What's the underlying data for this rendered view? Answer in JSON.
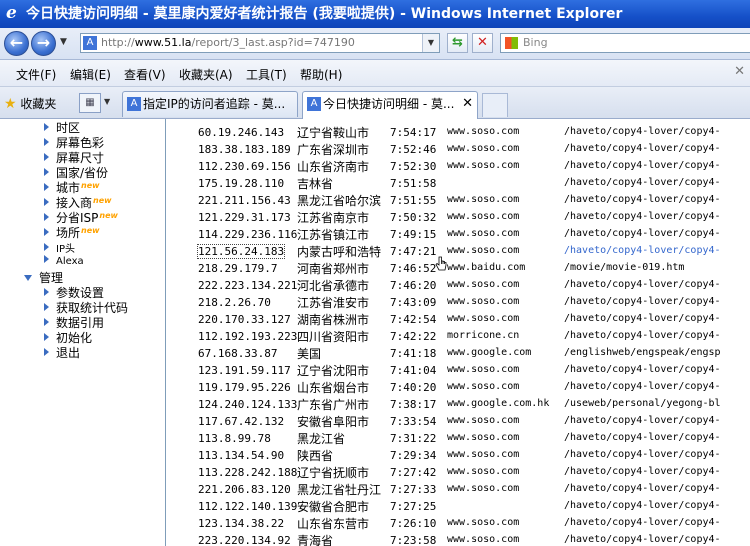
{
  "window": {
    "title": "今日快捷访问明细 - 莫里康内爱好者统计报告 (我要啦提供) - Windows Internet Explorer"
  },
  "navbar": {
    "back_icon": "back-arrow-icon",
    "forward_icon": "forward-arrow-icon",
    "address_prefix": "http://",
    "address_host": "www.51.la",
    "address_path": "/report/3_last.asp?id=747190",
    "search_placeholder": "Bing"
  },
  "menu": {
    "items": [
      "文件(F)",
      "编辑(E)",
      "查看(V)",
      "收藏夹(A)",
      "工具(T)",
      "帮助(H)"
    ],
    "close_label": "✕"
  },
  "tabs": {
    "favorites_label": "收藏夹",
    "items": [
      {
        "label": "指定IP的访问者追踪 - 莫...",
        "active": false
      },
      {
        "label": "今日快捷访问明细 - 莫...",
        "active": true
      }
    ]
  },
  "sidebar": {
    "items": [
      {
        "label": "时区",
        "new": false
      },
      {
        "label": "屏幕色彩",
        "new": false
      },
      {
        "label": "屏幕尺寸",
        "new": false
      },
      {
        "label": "国家/省份",
        "new": false
      },
      {
        "label": "城市",
        "new": true
      },
      {
        "label": "接入商",
        "new": true
      },
      {
        "label": "分省ISP",
        "new": true
      },
      {
        "label": "场所",
        "new": true
      },
      {
        "label": "IP头",
        "new": false
      },
      {
        "label": "Alexa",
        "new": false
      }
    ],
    "section_label": "管理",
    "manage_items": [
      "参数设置",
      "获取统计代码",
      "数据引用",
      "初始化",
      "退出"
    ],
    "new_badge_text": "new"
  },
  "rows": [
    {
      "ip": "60.19.246.143",
      "loc": "辽宁省鞍山市",
      "time": "7:54:17",
      "src": "www.soso.com",
      "page": "/haveto/copy4-lover/copy4-"
    },
    {
      "ip": "183.38.183.189",
      "loc": "广东省深圳市",
      "time": "7:52:46",
      "src": "www.soso.com",
      "page": "/haveto/copy4-lover/copy4-"
    },
    {
      "ip": "112.230.69.156",
      "loc": "山东省济南市",
      "time": "7:52:30",
      "src": "www.soso.com",
      "page": "/haveto/copy4-lover/copy4-"
    },
    {
      "ip": "175.19.28.110",
      "loc": "吉林省",
      "time": "7:51:58",
      "src": "",
      "page": "/haveto/copy4-lover/copy4-"
    },
    {
      "ip": "221.211.156.43",
      "loc": "黑龙江省哈尔滨",
      "time": "7:51:55",
      "src": "www.soso.com",
      "page": "/haveto/copy4-lover/copy4-"
    },
    {
      "ip": "121.229.31.173",
      "loc": "江苏省南京市",
      "time": "7:50:32",
      "src": "www.soso.com",
      "page": "/haveto/copy4-lover/copy4-"
    },
    {
      "ip": "114.229.236.116",
      "loc": "江苏省镇江市",
      "time": "7:49:15",
      "src": "www.soso.com",
      "page": "/haveto/copy4-lover/copy4-"
    },
    {
      "ip": "121.56.24.183",
      "loc": "内蒙古呼和浩特",
      "time": "7:47:21",
      "src": "www.soso.com",
      "page": "/haveto/copy4-lover/copy4-"
    },
    {
      "ip": "218.29.179.7",
      "loc": "河南省郑州市",
      "time": "7:46:52",
      "src": "www.baidu.com",
      "page": "/movie/movie-019.htm"
    },
    {
      "ip": "222.223.134.221",
      "loc": "河北省承德市",
      "time": "7:46:20",
      "src": "www.soso.com",
      "page": "/haveto/copy4-lover/copy4-"
    },
    {
      "ip": "218.2.26.70",
      "loc": "江苏省淮安市",
      "time": "7:43:09",
      "src": "www.soso.com",
      "page": "/haveto/copy4-lover/copy4-"
    },
    {
      "ip": "220.170.33.127",
      "loc": "湖南省株洲市",
      "time": "7:42:54",
      "src": "www.soso.com",
      "page": "/haveto/copy4-lover/copy4-"
    },
    {
      "ip": "112.192.193.223",
      "loc": "四川省资阳市",
      "time": "7:42:22",
      "src": "morricone.cn",
      "page": "/haveto/copy4-lover/copy4-"
    },
    {
      "ip": "67.168.33.87",
      "loc": "美国",
      "time": "7:41:18",
      "src": "www.google.com",
      "page": "/englishweb/engspeak/engsp"
    },
    {
      "ip": "123.191.59.117",
      "loc": "辽宁省沈阳市",
      "time": "7:41:04",
      "src": "www.soso.com",
      "page": "/haveto/copy4-lover/copy4-"
    },
    {
      "ip": "119.179.95.226",
      "loc": "山东省烟台市",
      "time": "7:40:20",
      "src": "www.soso.com",
      "page": "/haveto/copy4-lover/copy4-"
    },
    {
      "ip": "124.240.124.133",
      "loc": "广东省广州市",
      "time": "7:38:17",
      "src": "www.google.com.hk",
      "page": "/useweb/personal/yegong-bl"
    },
    {
      "ip": "117.67.42.132",
      "loc": "安徽省阜阳市",
      "time": "7:33:54",
      "src": "www.soso.com",
      "page": "/haveto/copy4-lover/copy4-"
    },
    {
      "ip": "113.8.99.78",
      "loc": "黑龙江省",
      "time": "7:31:22",
      "src": "www.soso.com",
      "page": "/haveto/copy4-lover/copy4-"
    },
    {
      "ip": "113.134.54.90",
      "loc": "陕西省",
      "time": "7:29:34",
      "src": "www.soso.com",
      "page": "/haveto/copy4-lover/copy4-"
    },
    {
      "ip": "113.228.242.188",
      "loc": "辽宁省抚顺市",
      "time": "7:27:42",
      "src": "www.soso.com",
      "page": "/haveto/copy4-lover/copy4-"
    },
    {
      "ip": "221.206.83.120",
      "loc": "黑龙江省牡丹江",
      "time": "7:27:33",
      "src": "www.soso.com",
      "page": "/haveto/copy4-lover/copy4-"
    },
    {
      "ip": "112.122.140.139",
      "loc": "安徽省合肥市",
      "time": "7:27:25",
      "src": "",
      "page": "/haveto/copy4-lover/copy4-"
    },
    {
      "ip": "123.134.38.22",
      "loc": "山东省东营市",
      "time": "7:26:10",
      "src": "www.soso.com",
      "page": "/haveto/copy4-lover/copy4-"
    },
    {
      "ip": "223.220.134.92",
      "loc": "青海省",
      "time": "7:23:58",
      "src": "www.soso.com",
      "page": "/haveto/copy4-lover/copy4-"
    }
  ]
}
